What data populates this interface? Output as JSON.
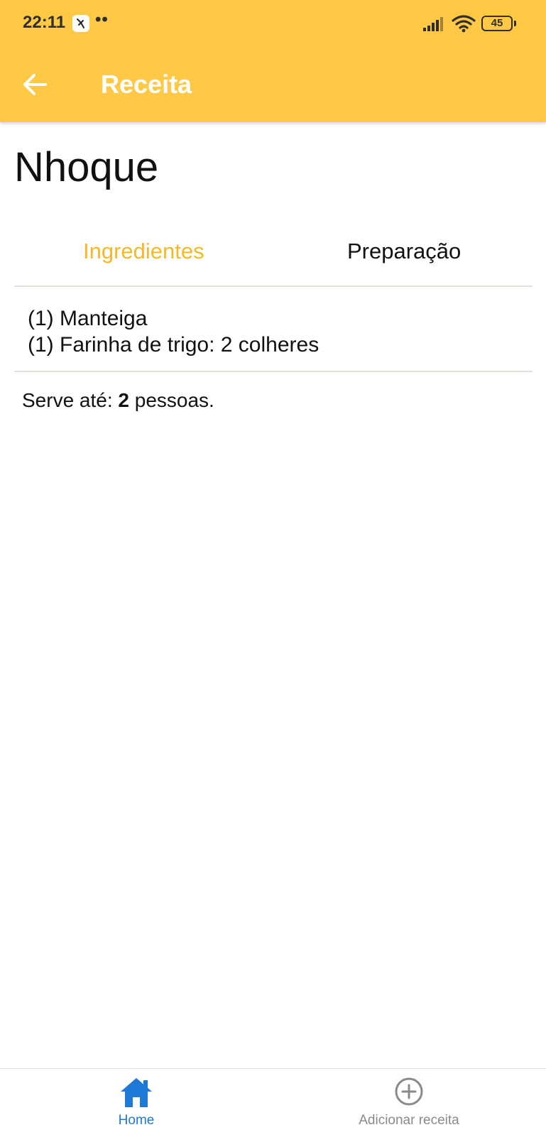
{
  "status_bar": {
    "time": "22:11",
    "dots": "••",
    "battery": "45"
  },
  "header": {
    "title": "Receita",
    "back_icon": "arrow-left-icon"
  },
  "recipe": {
    "title": "Nhoque"
  },
  "tabs": [
    {
      "label": "Ingredientes",
      "active": true
    },
    {
      "label": "Preparação",
      "active": false
    }
  ],
  "ingredients": [
    "(1) Manteiga",
    "(1) Farinha de trigo: 2 colheres"
  ],
  "serves": {
    "prefix": "Serve até: ",
    "count": "2",
    "suffix": " pessoas."
  },
  "bottom_nav": [
    {
      "label": "Home",
      "icon": "home-icon",
      "active": true
    },
    {
      "label": "Adicionar receita",
      "icon": "plus-circle-icon",
      "active": false
    }
  ],
  "colors": {
    "header_background": "#FFC845",
    "active_tab": "#F5B829",
    "nav_active": "#1E78D6",
    "nav_inactive": "#8a8a8a"
  }
}
